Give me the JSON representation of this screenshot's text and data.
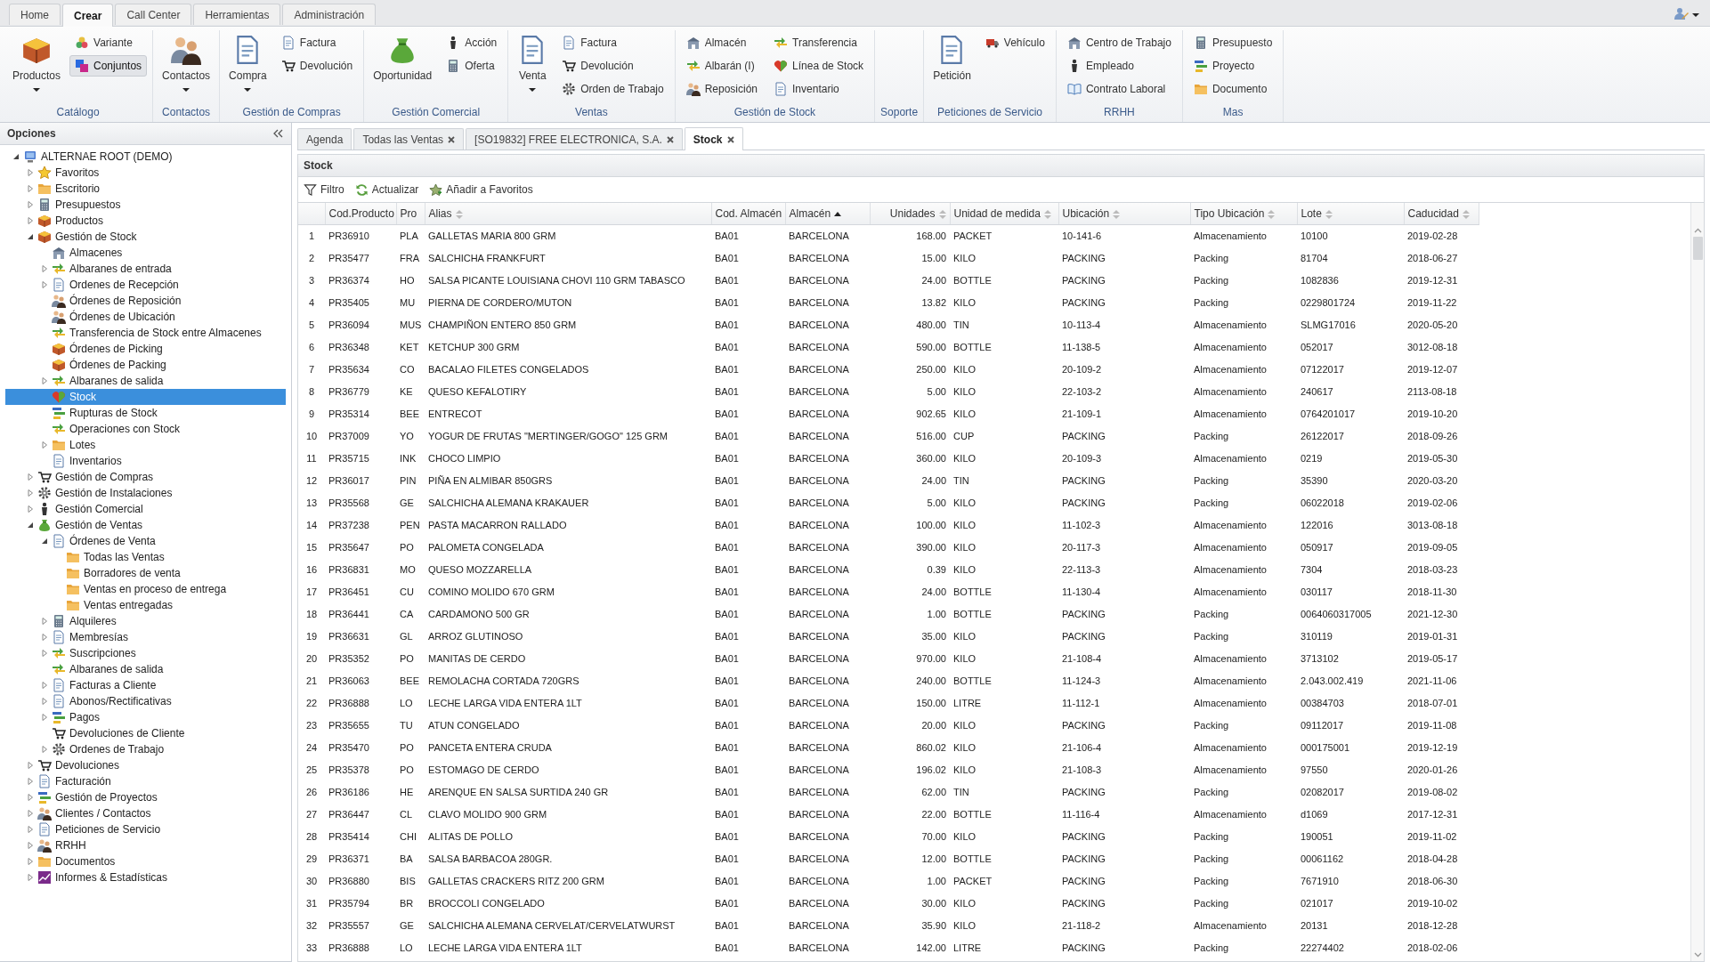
{
  "ribbon_tabs": [
    {
      "label": "Home",
      "selected": false
    },
    {
      "label": "Crear",
      "selected": true
    },
    {
      "label": "Call Center",
      "selected": false
    },
    {
      "label": "Herramientas",
      "selected": false
    },
    {
      "label": "Administración",
      "selected": false
    }
  ],
  "ribbon_groups": [
    {
      "label": "Catálogo",
      "large": [
        {
          "label": "Productos",
          "dropdown": true
        }
      ],
      "small": [
        {
          "label": "Variante",
          "selected": false
        },
        {
          "label": "Conjuntos",
          "selected": true
        }
      ]
    },
    {
      "label": "Contactos",
      "large": [
        {
          "label": "Contactos",
          "dropdown": true
        }
      ]
    },
    {
      "label": "Gestión de Compras",
      "large": [
        {
          "label": "Compra",
          "dropdown": true
        }
      ],
      "small": [
        {
          "label": "Factura",
          "selected": false
        },
        {
          "label": "Devolución",
          "selected": false
        }
      ]
    },
    {
      "label": "Gestión Comercial",
      "large": [
        {
          "label": "Oportunidad",
          "dropdown": false
        }
      ],
      "small": [
        {
          "label": "Acción",
          "selected": false
        },
        {
          "label": "Oferta",
          "selected": false
        }
      ]
    },
    {
      "label": "Ventas",
      "large": [
        {
          "label": "Venta",
          "dropdown": true
        }
      ],
      "small": [
        {
          "label": "Factura",
          "selected": false
        },
        {
          "label": "Devolución",
          "selected": false
        },
        {
          "label": "Orden de Trabajo",
          "selected": false
        }
      ]
    },
    {
      "label": "Gestión de Stock",
      "small": [
        {
          "label": "Almacén",
          "selected": false
        },
        {
          "label": "Albarán (I)",
          "selected": false
        },
        {
          "label": "Reposición",
          "selected": false
        },
        {
          "label": "Transferencia",
          "selected": false
        },
        {
          "label": "Línea de Stock",
          "selected": false
        },
        {
          "label": "Inventario",
          "selected": false
        }
      ]
    },
    {
      "label": "Soporte"
    },
    {
      "label": "Peticiones de Servicio",
      "large": [
        {
          "label": "Petición",
          "dropdown": false
        }
      ],
      "small": [
        {
          "label": "Vehículo",
          "selected": false
        }
      ]
    },
    {
      "label": "RRHH",
      "small": [
        {
          "label": "Centro de Trabajo",
          "selected": false
        },
        {
          "label": "Empleado",
          "selected": false
        },
        {
          "label": "Contrato Laboral",
          "selected": false
        }
      ]
    },
    {
      "label": "Mas",
      "small": [
        {
          "label": "Presupuesto",
          "selected": false
        },
        {
          "label": "Proyecto",
          "selected": false
        },
        {
          "label": "Documento",
          "selected": false
        }
      ]
    }
  ],
  "sidebar": {
    "title": "Opciones",
    "tree": [
      {
        "label": "ALTERNAE ROOT (DEMO)",
        "kind": "branch",
        "expanded": true,
        "selected": false,
        "children": [
          {
            "label": "Favoritos",
            "kind": "branch",
            "expanded": false,
            "selected": false
          },
          {
            "label": "Escritorio",
            "kind": "branch",
            "expanded": false,
            "selected": false
          },
          {
            "label": "Presupuestos",
            "kind": "branch",
            "expanded": false,
            "selected": false
          },
          {
            "label": "Productos",
            "kind": "branch",
            "expanded": false,
            "selected": false
          },
          {
            "label": "Gestión de Stock",
            "kind": "branch",
            "expanded": true,
            "selected": false,
            "children": [
              {
                "label": "Almacenes",
                "kind": "leaf",
                "selected": false
              },
              {
                "label": "Albaranes de entrada",
                "kind": "branch",
                "expanded": false,
                "selected": false
              },
              {
                "label": "Ordenes de Recepción",
                "kind": "branch",
                "expanded": false,
                "selected": false
              },
              {
                "label": "Órdenes de Reposición",
                "kind": "leaf",
                "selected": false
              },
              {
                "label": "Órdenes de Ubicación",
                "kind": "leaf",
                "selected": false
              },
              {
                "label": "Transferencia de Stock entre Almacenes",
                "kind": "leaf",
                "selected": false
              },
              {
                "label": "Órdenes de Picking",
                "kind": "leaf",
                "selected": false
              },
              {
                "label": "Órdenes de Packing",
                "kind": "leaf",
                "selected": false
              },
              {
                "label": "Albaranes de salida",
                "kind": "branch",
                "expanded": false,
                "selected": false
              },
              {
                "label": "Stock",
                "kind": "leaf",
                "selected": true
              },
              {
                "label": "Rupturas de Stock",
                "kind": "leaf",
                "selected": false
              },
              {
                "label": "Operaciones con Stock",
                "kind": "leaf",
                "selected": false
              },
              {
                "label": "Lotes",
                "kind": "branch",
                "expanded": false,
                "selected": false
              },
              {
                "label": "Inventarios",
                "kind": "leaf",
                "selected": false
              }
            ]
          },
          {
            "label": "Gestión de Compras",
            "kind": "branch",
            "expanded": false,
            "selected": false
          },
          {
            "label": "Gestión de Instalaciones",
            "kind": "branch",
            "expanded": false,
            "selected": false
          },
          {
            "label": "Gestión Comercial",
            "kind": "branch",
            "expanded": false,
            "selected": false
          },
          {
            "label": "Gestión de Ventas",
            "kind": "branch",
            "expanded": true,
            "selected": false,
            "children": [
              {
                "label": "Órdenes de Venta",
                "kind": "branch",
                "expanded": true,
                "selected": false,
                "children": [
                  {
                    "label": "Todas las Ventas",
                    "kind": "leaf",
                    "selected": false
                  },
                  {
                    "label": "Borradores de venta",
                    "kind": "leaf",
                    "selected": false
                  },
                  {
                    "label": "Ventas en proceso de entrega",
                    "kind": "leaf",
                    "selected": false
                  },
                  {
                    "label": "Ventas entregadas",
                    "kind": "leaf",
                    "selected": false
                  }
                ]
              },
              {
                "label": "Alquileres",
                "kind": "branch",
                "expanded": false,
                "selected": false
              },
              {
                "label": "Membresías",
                "kind": "branch",
                "expanded": false,
                "selected": false
              },
              {
                "label": "Suscripciones",
                "kind": "branch",
                "expanded": false,
                "selected": false
              },
              {
                "label": "Albaranes de salida",
                "kind": "leaf",
                "selected": false
              },
              {
                "label": "Facturas a Cliente",
                "kind": "branch",
                "expanded": false,
                "selected": false
              },
              {
                "label": "Abonos/Rectificativas",
                "kind": "branch",
                "expanded": false,
                "selected": false
              },
              {
                "label": "Pagos",
                "kind": "branch",
                "expanded": false,
                "selected": false
              },
              {
                "label": "Devoluciones de Cliente",
                "kind": "leaf",
                "selected": false
              },
              {
                "label": "Ordenes de Trabajo",
                "kind": "branch",
                "expanded": false,
                "selected": false
              }
            ]
          },
          {
            "label": "Devoluciones",
            "kind": "branch",
            "expanded": false,
            "selected": false
          },
          {
            "label": "Facturación",
            "kind": "branch",
            "expanded": false,
            "selected": false
          },
          {
            "label": "Gestión de Proyectos",
            "kind": "branch",
            "expanded": false,
            "selected": false
          },
          {
            "label": "Clientes / Contactos",
            "kind": "branch",
            "expanded": false,
            "selected": false
          },
          {
            "label": "Peticiones de Servicio",
            "kind": "branch",
            "expanded": false,
            "selected": false
          },
          {
            "label": "RRHH",
            "kind": "branch",
            "expanded": false,
            "selected": false
          },
          {
            "label": "Documentos",
            "kind": "branch",
            "expanded": false,
            "selected": false
          },
          {
            "label": "Informes & Estadísticas",
            "kind": "branch",
            "expanded": false,
            "selected": false
          }
        ]
      }
    ]
  },
  "document_tabs": [
    {
      "label": "Agenda",
      "closable": false,
      "selected": false
    },
    {
      "label": "Todas las Ventas",
      "closable": true,
      "selected": false
    },
    {
      "label": "[SO19832] FREE ELECTRONICA, S.A.",
      "closable": true,
      "selected": false
    },
    {
      "label": "Stock",
      "closable": true,
      "selected": true
    }
  ],
  "panel_title": "Stock",
  "toolbar": [
    "Filtro",
    "Actualizar",
    "Añadir a Favoritos"
  ],
  "table": {
    "columns": [
      {
        "kind": "index",
        "sortable": false,
        "sorted": false
      },
      {
        "label": "Cod.Producto",
        "kind": "text",
        "sortable": false,
        "sorted": false
      },
      {
        "label": "Pro",
        "kind": "text",
        "sortable": false,
        "sorted": false
      },
      {
        "label": "Alias",
        "kind": "text",
        "sortable": true,
        "sorted": false
      },
      {
        "label": "Cod. Almacén",
        "kind": "text",
        "sortable": false,
        "sorted": false
      },
      {
        "label": "Almacén",
        "kind": "text",
        "sortable": false,
        "sorted": true
      },
      {
        "label": "Unidades",
        "kind": "number",
        "sortable": true,
        "sorted": false
      },
      {
        "label": "Unidad de medida",
        "kind": "text",
        "sortable": true,
        "sorted": false
      },
      {
        "label": "Ubicación",
        "kind": "text",
        "sortable": true,
        "sorted": false
      },
      {
        "label": "Tipo Ubicación",
        "kind": "text",
        "sortable": true,
        "sorted": false
      },
      {
        "label": "Lote",
        "kind": "text",
        "sortable": true,
        "sorted": false
      },
      {
        "label": "Caducidad",
        "kind": "text",
        "sortable": true,
        "sorted": false
      }
    ],
    "rows": [
      [
        "1",
        "PR36910",
        "PLA",
        "GALLETAS MARIA 800 GRM",
        "BA01",
        "BARCELONA",
        "168.00",
        "PACKET",
        "10-141-6",
        "Almacenamiento",
        "10100",
        "2019-02-28"
      ],
      [
        "2",
        "PR35477",
        "FRA",
        "SALCHICHA FRANKFURT",
        "BA01",
        "BARCELONA",
        "15.00",
        "KILO",
        "PACKING",
        "Packing",
        "81704",
        "2018-06-27"
      ],
      [
        "3",
        "PR36374",
        "HO",
        "SALSA PICANTE LOUISIANA CHOVI 110 GRM TABASCO",
        "BA01",
        "BARCELONA",
        "24.00",
        "BOTTLE",
        "PACKING",
        "Packing",
        "1082836",
        "2019-12-31"
      ],
      [
        "4",
        "PR35405",
        "MU",
        "PIERNA DE CORDERO/MUTON",
        "BA01",
        "BARCELONA",
        "13.82",
        "KILO",
        "PACKING",
        "Packing",
        "0229801724",
        "2019-11-22"
      ],
      [
        "5",
        "PR36094",
        "MUS",
        "CHAMPIÑON ENTERO 850 GRM",
        "BA01",
        "BARCELONA",
        "480.00",
        "TIN",
        "10-113-4",
        "Almacenamiento",
        "SLMG17016",
        "2020-05-20"
      ],
      [
        "6",
        "PR36348",
        "KET",
        "KETCHUP 300 GRM",
        "BA01",
        "BARCELONA",
        "590.00",
        "BOTTLE",
        "11-138-5",
        "Almacenamiento",
        "052017",
        "3012-08-18"
      ],
      [
        "7",
        "PR35634",
        "CO",
        "BACALAO FILETES CONGELADOS",
        "BA01",
        "BARCELONA",
        "250.00",
        "KILO",
        "20-109-2",
        "Almacenamiento",
        "07122017",
        "2019-12-07"
      ],
      [
        "8",
        "PR36779",
        "KE",
        "QUESO KEFALOTIRY",
        "BA01",
        "BARCELONA",
        "5.00",
        "KILO",
        "22-103-2",
        "Almacenamiento",
        "240617",
        "2113-08-18"
      ],
      [
        "9",
        "PR35314",
        "BEE",
        "ENTRECOT",
        "BA01",
        "BARCELONA",
        "902.65",
        "KILO",
        "21-109-1",
        "Almacenamiento",
        "0764201017",
        "2019-10-20"
      ],
      [
        "10",
        "PR37009",
        "YO",
        "YOGUR DE FRUTAS \"MERTINGER/GOGO\" 125 GRM",
        "BA01",
        "BARCELONA",
        "516.00",
        "CUP",
        "PACKING",
        "Packing",
        "26122017",
        "2018-09-26"
      ],
      [
        "11",
        "PR35715",
        "INK",
        "CHOCO LIMPIO",
        "BA01",
        "BARCELONA",
        "360.00",
        "KILO",
        "20-109-3",
        "Almacenamiento",
        "0219",
        "2019-05-30"
      ],
      [
        "12",
        "PR36017",
        "PIN",
        "PIÑA EN ALMIBAR 850GRS",
        "BA01",
        "BARCELONA",
        "24.00",
        "TIN",
        "PACKING",
        "Packing",
        "35390",
        "2020-03-20"
      ],
      [
        "13",
        "PR35568",
        "GE",
        "SALCHICHA ALEMANA KRAKAUER",
        "BA01",
        "BARCELONA",
        "5.00",
        "KILO",
        "PACKING",
        "Packing",
        "06022018",
        "2019-02-06"
      ],
      [
        "14",
        "PR37238",
        "PEN",
        "PASTA MACARRON RALLADO",
        "BA01",
        "BARCELONA",
        "100.00",
        "KILO",
        "11-102-3",
        "Almacenamiento",
        "122016",
        "3013-08-18"
      ],
      [
        "15",
        "PR35647",
        "PO",
        "PALOMETA CONGELADA",
        "BA01",
        "BARCELONA",
        "390.00",
        "KILO",
        "20-117-3",
        "Almacenamiento",
        "050917",
        "2019-09-05"
      ],
      [
        "16",
        "PR36831",
        "MO",
        "QUESO MOZZARELLA",
        "BA01",
        "BARCELONA",
        "0.39",
        "KILO",
        "22-113-3",
        "Almacenamiento",
        "7304",
        "2018-03-23"
      ],
      [
        "17",
        "PR36451",
        "CU",
        "COMINO MOLIDO 670 GRM",
        "BA01",
        "BARCELONA",
        "24.00",
        "BOTTLE",
        "11-130-4",
        "Almacenamiento",
        "030117",
        "2018-11-30"
      ],
      [
        "18",
        "PR36441",
        "CA",
        "CARDAMONO 500 GR",
        "BA01",
        "BARCELONA",
        "1.00",
        "BOTTLE",
        "PACKING",
        "Packing",
        "0064060317005",
        "2021-12-30"
      ],
      [
        "19",
        "PR36631",
        "GL",
        "ARROZ GLUTINOSO",
        "BA01",
        "BARCELONA",
        "35.00",
        "KILO",
        "PACKING",
        "Packing",
        "310119",
        "2019-01-31"
      ],
      [
        "20",
        "PR35352",
        "PO",
        "MANITAS DE CERDO",
        "BA01",
        "BARCELONA",
        "970.00",
        "KILO",
        "21-108-4",
        "Almacenamiento",
        "3713102",
        "2019-05-17"
      ],
      [
        "21",
        "PR36063",
        "BEE",
        "REMOLACHA CORTADA 720GRS",
        "BA01",
        "BARCELONA",
        "240.00",
        "BOTTLE",
        "11-124-3",
        "Almacenamiento",
        "2.043.002.419",
        "2021-11-06"
      ],
      [
        "22",
        "PR36888",
        "LO",
        "LECHE LARGA VIDA ENTERA 1LT",
        "BA01",
        "BARCELONA",
        "150.00",
        "LITRE",
        "11-112-1",
        "Almacenamiento",
        "00384703",
        "2018-07-01"
      ],
      [
        "23",
        "PR35655",
        "TU",
        "ATUN CONGELADO",
        "BA01",
        "BARCELONA",
        "20.00",
        "KILO",
        "PACKING",
        "Packing",
        "09112017",
        "2019-11-08"
      ],
      [
        "24",
        "PR35470",
        "PO",
        "PANCETA ENTERA CRUDA",
        "BA01",
        "BARCELONA",
        "860.02",
        "KILO",
        "21-106-4",
        "Almacenamiento",
        "000175001",
        "2019-12-19"
      ],
      [
        "25",
        "PR35378",
        "PO",
        "ESTOMAGO DE CERDO",
        "BA01",
        "BARCELONA",
        "196.02",
        "KILO",
        "21-108-3",
        "Almacenamiento",
        "97550",
        "2020-01-26"
      ],
      [
        "26",
        "PR36186",
        "HE",
        "ARENQUE EN SALSA SURTIDA 240 GR",
        "BA01",
        "BARCELONA",
        "62.00",
        "TIN",
        "PACKING",
        "Packing",
        "02082017",
        "2019-08-02"
      ],
      [
        "27",
        "PR36447",
        "CL",
        "CLAVO MOLIDO 900 GRM",
        "BA01",
        "BARCELONA",
        "22.00",
        "BOTTLE",
        "11-116-4",
        "Almacenamiento",
        "d1069",
        "2017-12-31"
      ],
      [
        "28",
        "PR35414",
        "CHI",
        "ALITAS DE POLLO",
        "BA01",
        "BARCELONA",
        "70.00",
        "KILO",
        "PACKING",
        "Packing",
        "190051",
        "2019-11-02"
      ],
      [
        "29",
        "PR36371",
        "BA",
        "SALSA BARBACOA 280GR.",
        "BA01",
        "BARCELONA",
        "12.00",
        "BOTTLE",
        "PACKING",
        "Packing",
        "00061162",
        "2018-04-28"
      ],
      [
        "30",
        "PR36880",
        "BIS",
        "GALLETAS CRACKERS RITZ 200 GRM",
        "BA01",
        "BARCELONA",
        "1.00",
        "PACKET",
        "PACKING",
        "Packing",
        "7671910",
        "2018-06-30"
      ],
      [
        "31",
        "PR35794",
        "BR",
        "BROCCOLI CONGELADO",
        "BA01",
        "BARCELONA",
        "30.00",
        "KILO",
        "PACKING",
        "Packing",
        "021017",
        "2019-10-02"
      ],
      [
        "32",
        "PR35557",
        "GE",
        "SALCHICHA ALEMANA CERVELAT/CERVELATWURST",
        "BA01",
        "BARCELONA",
        "35.90",
        "KILO",
        "21-118-2",
        "Almacenamiento",
        "20131",
        "2018-12-28"
      ],
      [
        "33",
        "PR36888",
        "LO",
        "LECHE LARGA VIDA ENTERA 1LT",
        "BA01",
        "BARCELONA",
        "142.00",
        "LITRE",
        "PACKING",
        "Packing",
        "22274402",
        "2018-02-06"
      ]
    ]
  }
}
